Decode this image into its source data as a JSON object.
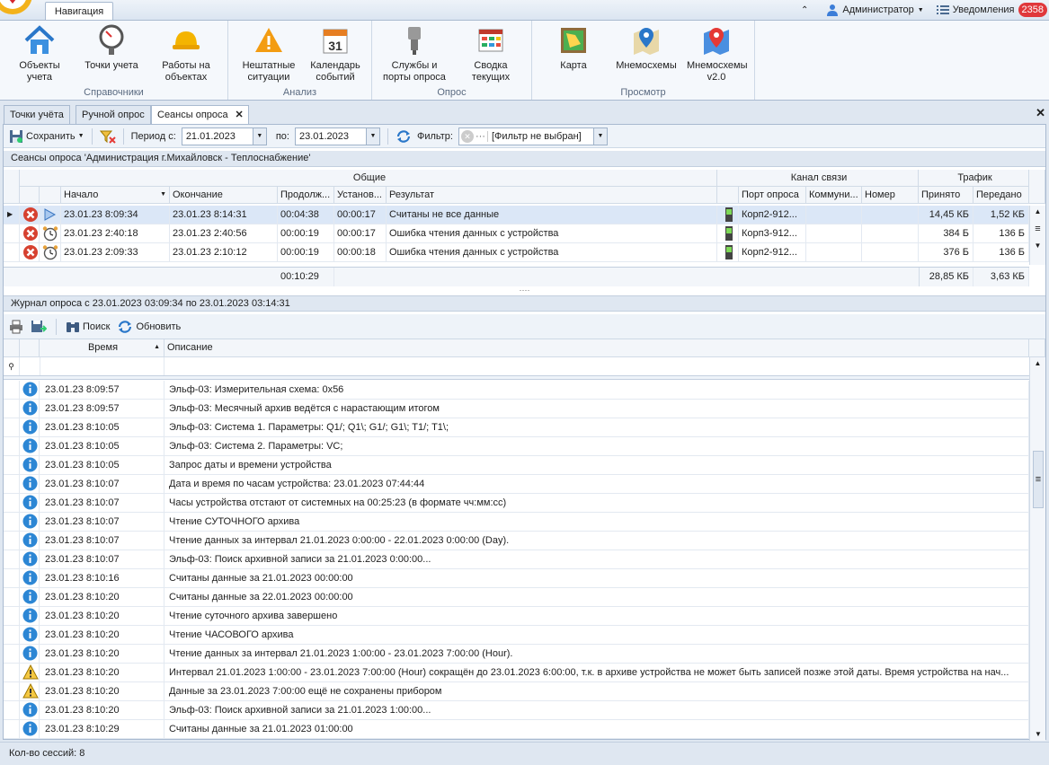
{
  "topbar": {
    "nav_tab": "Навигация",
    "user": "Администратор",
    "notifications_label": "Уведомления",
    "notifications_count": "2358"
  },
  "ribbon": {
    "groups": [
      {
        "label": "Справочники",
        "buttons": [
          "Объекты\nучета",
          "Точки учета",
          "Работы на\nобъектах"
        ]
      },
      {
        "label": "Анализ",
        "buttons": [
          "Нештатные\nситуации",
          "Календарь\nсобытий"
        ]
      },
      {
        "label": "Опрос",
        "buttons": [
          "Службы и\nпорты опроса",
          "Сводка\nтекущих"
        ]
      },
      {
        "label": "Просмотр",
        "buttons": [
          "Карта",
          "Мнемосхемы",
          "Мнемосхемы\nv2.0"
        ]
      }
    ],
    "b": {
      "objects": "Объекты учета",
      "points": "Точки учета",
      "works": "Работы на объектах",
      "emergency": "Нештатные ситуации",
      "calendar": "Календарь событий",
      "calendar_day": "31",
      "services": "Службы и порты опроса",
      "summary": "Сводка текущих",
      "map": "Карта",
      "mnemo": "Мнемосхемы",
      "mnemo2": "Мнемосхемы v2.0"
    },
    "g": {
      "ref": "Справочники",
      "analysis": "Анализ",
      "poll": "Опрос",
      "view": "Просмотр"
    }
  },
  "doc_tabs": [
    "Точки учёта",
    "Ручной опрос",
    "Сеансы опроса"
  ],
  "toolbar1": {
    "save": "Сохранить",
    "period_from_label": "Период с:",
    "period_from": "21.01.2023",
    "period_to_label": "по:",
    "period_to": "23.01.2023",
    "filter_label": "Фильтр:",
    "filter_value": "[Фильтр не выбран]"
  },
  "sessions": {
    "caption": "Сеансы опроса 'Администрация г.Михайловск - Теплоснабжение'",
    "band_general": "Общие",
    "band_channel": "Канал связи",
    "band_traffic": "Трафик",
    "columns": [
      "Начало",
      "Окончание",
      "Продолж...",
      "Установ...",
      "Результат",
      "Порт опроса",
      "Коммуни...",
      "Номер",
      "Принято",
      "Передано"
    ],
    "rows": [
      {
        "start": "23.01.23 8:09:34",
        "end": "23.01.23 8:14:31",
        "duration": "00:04:38",
        "setup": "00:00:17",
        "result": "Считаны не все данные",
        "port": "Корп2-912...",
        "comm": "",
        "number": "",
        "received": "14,45 КБ",
        "sent": "1,52 КБ"
      },
      {
        "start": "23.01.23 2:40:18",
        "end": "23.01.23 2:40:56",
        "duration": "00:00:19",
        "setup": "00:00:17",
        "result": "Ошибка чтения данных с устройства",
        "port": "Корп3-912...",
        "comm": "",
        "number": "",
        "received": "384 Б",
        "sent": "136 Б"
      },
      {
        "start": "23.01.23 2:09:33",
        "end": "23.01.23 2:10:12",
        "duration": "00:00:19",
        "setup": "00:00:18",
        "result": "Ошибка чтения данных с устройства",
        "port": "Корп2-912...",
        "comm": "",
        "number": "",
        "received": "376 Б",
        "sent": "136 Б"
      }
    ],
    "footer": {
      "duration": "00:10:29",
      "received": "28,85 КБ",
      "sent": "3,63 КБ"
    }
  },
  "journal": {
    "caption": "Журнал опроса с 23.01.2023 03:09:34 по 23.01.2023 03:14:31",
    "search": "Поиск",
    "refresh": "Обновить",
    "col_time": "Время",
    "col_desc": "Описание",
    "rows": [
      {
        "type": "info",
        "time": "23.01.23 8:09:57",
        "desc": "Эльф-03: Измерительная схема: 0x56"
      },
      {
        "type": "info",
        "time": "23.01.23 8:09:57",
        "desc": "Эльф-03: Месячный архив ведётся с нарастающим итогом"
      },
      {
        "type": "info",
        "time": "23.01.23 8:10:05",
        "desc": "Эльф-03: Система 1. Параметры: Q1/; Q1\\; G1/; G1\\; T1/; T1\\;"
      },
      {
        "type": "info",
        "time": "23.01.23 8:10:05",
        "desc": "Эльф-03: Система 2. Параметры: VC;"
      },
      {
        "type": "info",
        "time": "23.01.23 8:10:05",
        "desc": "Запрос даты и времени устройства"
      },
      {
        "type": "info",
        "time": "23.01.23 8:10:07",
        "desc": "Дата и время по часам устройства: 23.01.2023 07:44:44"
      },
      {
        "type": "info",
        "time": "23.01.23 8:10:07",
        "desc": "Часы устройства отстают от системных на 00:25:23 (в формате чч:мм:сс)"
      },
      {
        "type": "info",
        "time": "23.01.23 8:10:07",
        "desc": "Чтение СУТОЧНОГО архива"
      },
      {
        "type": "info",
        "time": "23.01.23 8:10:07",
        "desc": "Чтение данных за интервал 21.01.2023 0:00:00 - 22.01.2023 0:00:00 (Day)."
      },
      {
        "type": "info",
        "time": "23.01.23 8:10:07",
        "desc": "Эльф-03: Поиск архивной записи за 21.01.2023 0:00:00..."
      },
      {
        "type": "info",
        "time": "23.01.23 8:10:16",
        "desc": "Считаны данные за 21.01.2023 00:00:00"
      },
      {
        "type": "info",
        "time": "23.01.23 8:10:20",
        "desc": "Считаны данные за 22.01.2023 00:00:00"
      },
      {
        "type": "info",
        "time": "23.01.23 8:10:20",
        "desc": "Чтение суточного архива завершено"
      },
      {
        "type": "info",
        "time": "23.01.23 8:10:20",
        "desc": "Чтение ЧАСОВОГО архива"
      },
      {
        "type": "info",
        "time": "23.01.23 8:10:20",
        "desc": "Чтение данных за интервал 21.01.2023 1:00:00 - 23.01.2023 7:00:00 (Hour)."
      },
      {
        "type": "warn",
        "time": "23.01.23 8:10:20",
        "desc": "Интервал 21.01.2023 1:00:00 - 23.01.2023 7:00:00 (Hour) сокращён до 23.01.2023 6:00:00, т.к. в архиве устройства не может быть записей позже этой даты. Время устройства на нач..."
      },
      {
        "type": "warn",
        "time": "23.01.23 8:10:20",
        "desc": "Данные за 23.01.2023 7:00:00 ещё не сохранены прибором"
      },
      {
        "type": "info",
        "time": "23.01.23 8:10:20",
        "desc": "Эльф-03: Поиск архивной записи за 21.01.2023 1:00:00..."
      },
      {
        "type": "info",
        "time": "23.01.23 8:10:29",
        "desc": "Считаны данные за 21.01.2023 01:00:00"
      }
    ]
  },
  "status": {
    "sessions_count": "Кол-во сессий: 8"
  }
}
